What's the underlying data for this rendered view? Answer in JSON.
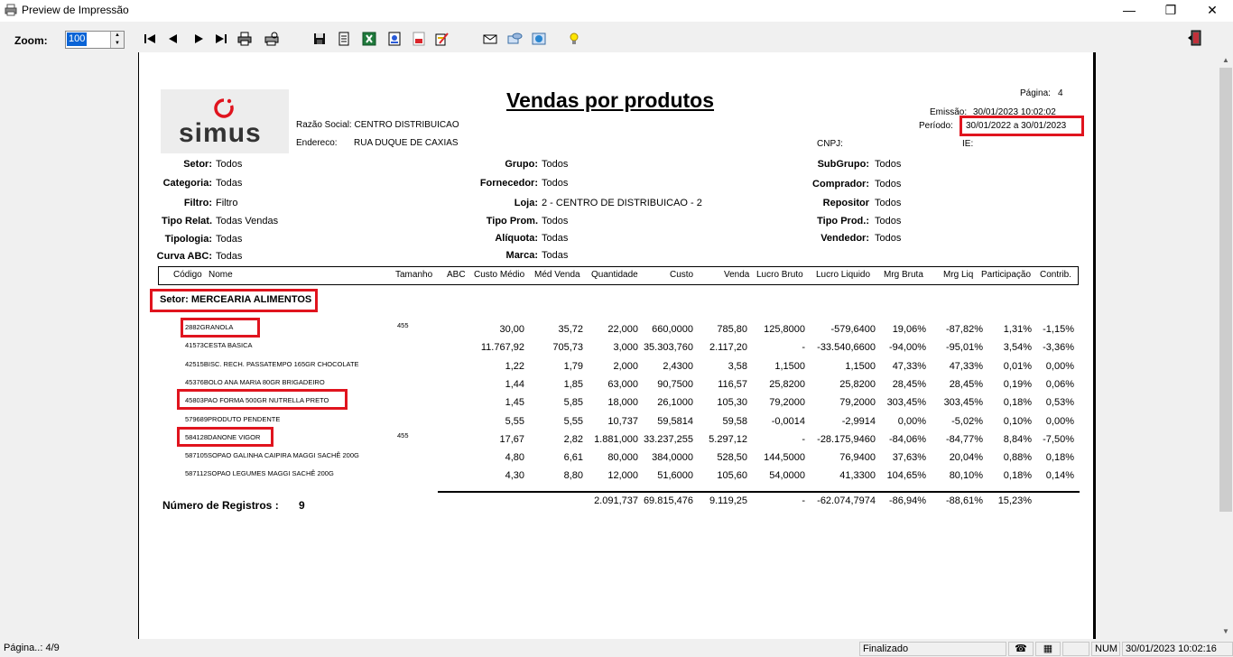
{
  "window": {
    "title": "Preview de Impressão",
    "minimize_glyph": "—",
    "restore_glyph": "❐",
    "close_glyph": "✕"
  },
  "toolbar": {
    "zoom_label": "Zoom:",
    "zoom_value": "100",
    "icons": [
      "first-page-icon",
      "previous-page-icon",
      "next-page-icon",
      "last-page-icon",
      "print-icon",
      "printer-setup-icon",
      "save-icon",
      "text-export-icon",
      "excel-export-icon",
      "word-export-icon",
      "pdf-export-icon",
      "edit-icon",
      "email-icon",
      "send-icon",
      "web-export-icon",
      "lightbulb-icon",
      "exit-door-icon"
    ]
  },
  "report": {
    "logo_text": "simus",
    "title": "Vendas por produtos",
    "page_label": "Página:",
    "page_value": "4",
    "emissao_label": "Emissão:",
    "emissao_value": "30/01/2023 10:02:02",
    "periodo_label": "Período:",
    "periodo_value": "30/01/2022 a  30/01/2023",
    "razao_social": "Razão Social: CENTRO DISTRIBUICAO",
    "endereco_label": "Endereco:",
    "endereco_value": "RUA DUQUE DE CAXIAS",
    "cnpj_label": "CNPJ:",
    "ie_label": "IE:",
    "filters_left": [
      {
        "label": "Setor:",
        "value": "Todos"
      },
      {
        "label": "Categoria:",
        "value": "Todas"
      },
      {
        "label": "Filtro:",
        "value": "Filtro"
      },
      {
        "label": "Tipo Relat.",
        "value": "Todas Vendas"
      },
      {
        "label": "Tipologia:",
        "value": "Todas"
      },
      {
        "label": "Curva ABC:",
        "value": "Todas"
      }
    ],
    "filters_mid": [
      {
        "label": "Grupo:",
        "value": "Todos"
      },
      {
        "label": "Fornecedor:",
        "value": "Todos"
      },
      {
        "label": "Loja:",
        "value": "2 - CENTRO DE DISTRIBUICAO - 2"
      },
      {
        "label": "Tipo Prom.",
        "value": "Todos"
      },
      {
        "label": "Alíquota:",
        "value": "Todas"
      },
      {
        "label": "Marca:",
        "value": "Todas"
      }
    ],
    "filters_right": [
      {
        "label": "SubGrupo:",
        "value": "Todos"
      },
      {
        "label": "Comprador:",
        "value": "Todos"
      },
      {
        "label": "Repositor",
        "value": "Todos"
      },
      {
        "label": "Tipo Prod.:",
        "value": "Todos"
      },
      {
        "label": "Vendedor:",
        "value": "Todos"
      }
    ],
    "columns": [
      "Código",
      "Nome",
      "Tamanho",
      "ABC",
      "Custo Médio",
      "Méd Venda",
      "Quantidade",
      "Custo",
      "Venda",
      "Lucro Bruto",
      "Lucro Liquido",
      "Mrg Bruta",
      "Mrg Liq",
      "Participação",
      "Contrib."
    ],
    "setor": "Setor: MERCEARIA ALIMENTOS",
    "rows": [
      {
        "code": "2882",
        "name": "GRANOLA",
        "tamanho": "455",
        "vals": [
          "30,00",
          "35,72",
          "22,000",
          "660,0000",
          "785,80",
          "125,8000",
          "-579,6400",
          "19,06%",
          "-87,82%",
          "1,31%",
          "-1,15%"
        ]
      },
      {
        "code": "41573",
        "name": "CESTA BASICA",
        "tamanho": "",
        "vals": [
          "11.767,92",
          "705,73",
          "3,000",
          "35.303,760",
          "2.117,20",
          "-",
          "-33.540,6600",
          "-94,00%",
          "-95,01%",
          "3,54%",
          "-3,36%"
        ]
      },
      {
        "code": "42515",
        "name": "BISC. RECH. PASSATEMPO 165GR CHOCOLATE",
        "tamanho": "",
        "vals": [
          "1,22",
          "1,79",
          "2,000",
          "2,4300",
          "3,58",
          "1,1500",
          "1,1500",
          "47,33%",
          "47,33%",
          "0,01%",
          "0,00%"
        ]
      },
      {
        "code": "45376",
        "name": "BOLO ANA MARIA 80GR BRIGADEIRO",
        "tamanho": "",
        "vals": [
          "1,44",
          "1,85",
          "63,000",
          "90,7500",
          "116,57",
          "25,8200",
          "25,8200",
          "28,45%",
          "28,45%",
          "0,19%",
          "0,06%"
        ]
      },
      {
        "code": "45803",
        "name": "PAO FORMA 500GR NUTRELLA PRETO",
        "tamanho": "",
        "vals": [
          "1,45",
          "5,85",
          "18,000",
          "26,1000",
          "105,30",
          "79,2000",
          "79,2000",
          "303,45%",
          "303,45%",
          "0,18%",
          "0,53%"
        ]
      },
      {
        "code": "579689",
        "name": "PRODUTO PENDENTE",
        "tamanho": "",
        "vals": [
          "5,55",
          "5,55",
          "10,737",
          "59,5814",
          "59,58",
          "-0,0014",
          "-2,9914",
          "0,00%",
          "-5,02%",
          "0,10%",
          "0,00%"
        ]
      },
      {
        "code": "584128",
        "name": "DANONE VIGOR",
        "tamanho": "455",
        "vals": [
          "17,67",
          "2,82",
          "1.881,000",
          "33.237,255",
          "5.297,12",
          "-",
          "-28.175,9460",
          "-84,06%",
          "-84,77%",
          "8,84%",
          "-7,50%"
        ]
      },
      {
        "code": "587105",
        "name": "SOPAO GALINHA CAIPIRA MAGGI SACHÊ 200G",
        "tamanho": "",
        "vals": [
          "4,80",
          "6,61",
          "80,000",
          "384,0000",
          "528,50",
          "144,5000",
          "76,9400",
          "37,63%",
          "20,04%",
          "0,88%",
          "0,18%"
        ]
      },
      {
        "code": "587112",
        "name": "SOPAO LEGUMES MAGGI SACHÊ 200G",
        "tamanho": "",
        "vals": [
          "4,30",
          "8,80",
          "12,000",
          "51,6000",
          "105,60",
          "54,0000",
          "41,3300",
          "104,65%",
          "80,10%",
          "0,18%",
          "0,14%"
        ]
      }
    ],
    "registros_label": "Número de Registros :",
    "registros_value": "9",
    "totals": [
      "2.091,737",
      "69.815,476",
      "9.119,25",
      "-",
      "-62.074,7974",
      "-86,94%",
      "-88,61%",
      "15,23%"
    ]
  },
  "statusbar": {
    "page": "Página..: 4/9",
    "state": "Finalizado",
    "num": "NUM",
    "datetime": "30/01/2023 10:02:16"
  }
}
